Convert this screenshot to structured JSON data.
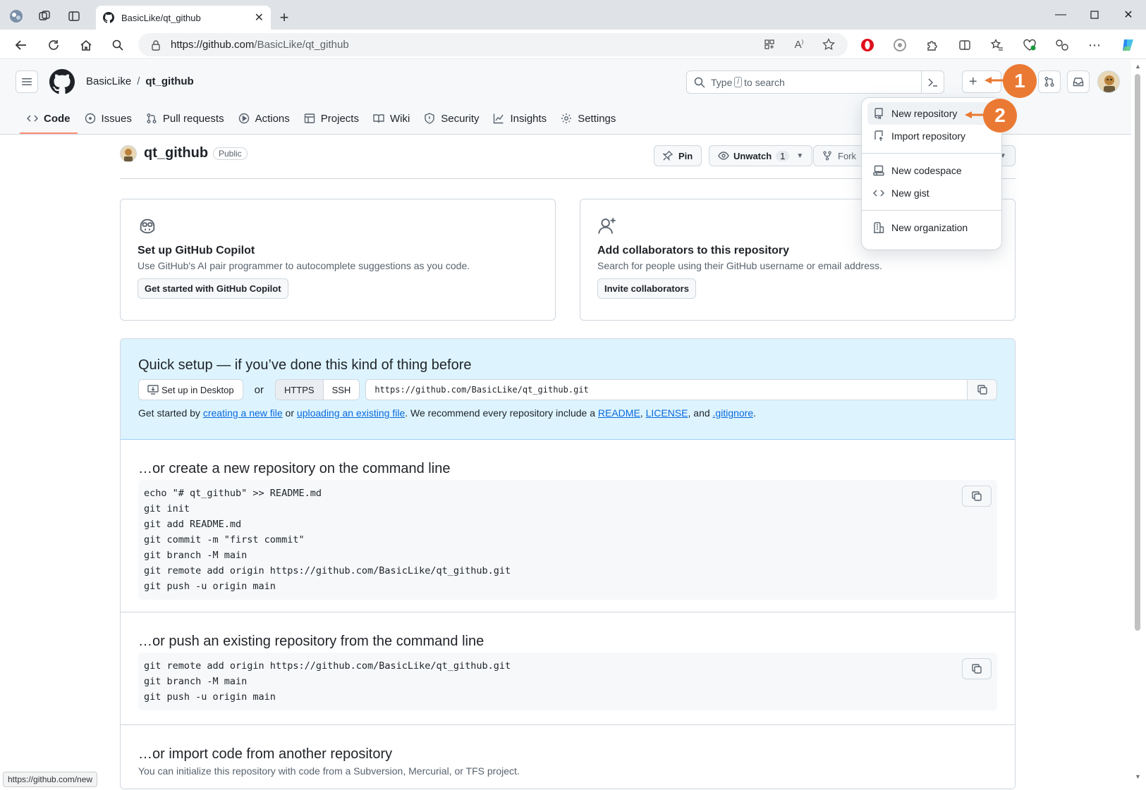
{
  "browser": {
    "tab_title": "BasicLike/qt_github",
    "url_host": "https://github.com",
    "url_path": "/BasicLike/qt_github",
    "status_url": "https://github.com/new"
  },
  "header": {
    "owner": "BasicLike",
    "separator": "/",
    "repo": "qt_github",
    "search_prefix": "Type",
    "search_key": "/",
    "search_suffix": "to search"
  },
  "repo_tabs": [
    {
      "label": "Code",
      "icon": "code-icon"
    },
    {
      "label": "Issues",
      "icon": "issue-icon"
    },
    {
      "label": "Pull requests",
      "icon": "pull-request-icon"
    },
    {
      "label": "Actions",
      "icon": "play-icon"
    },
    {
      "label": "Projects",
      "icon": "table-icon"
    },
    {
      "label": "Wiki",
      "icon": "book-icon"
    },
    {
      "label": "Security",
      "icon": "shield-icon"
    },
    {
      "label": "Insights",
      "icon": "graph-icon"
    },
    {
      "label": "Settings",
      "icon": "gear-icon"
    }
  ],
  "repo": {
    "name": "qt_github",
    "visibility": "Public",
    "pin_label": "Pin",
    "watch_label": "Unwatch",
    "watch_count": "1",
    "fork_label": "Fork"
  },
  "cards": {
    "copilot": {
      "title": "Set up GitHub Copilot",
      "desc": "Use GitHub's AI pair programmer to autocomplete suggestions as you code.",
      "button": "Get started with GitHub Copilot"
    },
    "collab": {
      "title": "Add collaborators to this repository",
      "desc": "Search for people using their GitHub username or email address.",
      "button": "Invite collaborators"
    }
  },
  "quick_setup": {
    "title": "Quick setup — if you’ve done this kind of thing before",
    "desktop_button": "Set up in Desktop",
    "or": "or",
    "https": "HTTPS",
    "ssh": "SSH",
    "clone_url": "https://github.com/BasicLike/qt_github.git",
    "t1": "Get started by ",
    "link1": "creating a new file",
    "t2": " or ",
    "link2": "uploading an existing file",
    "t3": ". We recommend every repository include a ",
    "link3": "README",
    "t4": ", ",
    "link4": "LICENSE",
    "t5": ", and ",
    "link5": ".gitignore",
    "t6": "."
  },
  "sections": {
    "create_title": "…or create a new repository on the command line",
    "create_code": [
      "echo \"# qt_github\" >> README.md",
      "git init",
      "git add README.md",
      "git commit -m \"first commit\"",
      "git branch -M main",
      "git remote add origin https://github.com/BasicLike/qt_github.git",
      "git push -u origin main"
    ],
    "push_title": "…or push an existing repository from the command line",
    "push_code": [
      "git remote add origin https://github.com/BasicLike/qt_github.git",
      "git branch -M main",
      "git push -u origin main"
    ],
    "import_title": "…or import code from another repository",
    "import_desc": "You can initialize this repository with code from a Subversion, Mercurial, or TFS project."
  },
  "dropdown": {
    "items": [
      {
        "label": "New repository",
        "icon": "repo-icon"
      },
      {
        "label": "Import repository",
        "icon": "repo-push-icon"
      },
      {
        "label": "New codespace",
        "icon": "codespaces-icon"
      },
      {
        "label": "New gist",
        "icon": "code-icon"
      },
      {
        "label": "New organization",
        "icon": "organization-icon"
      }
    ]
  },
  "callouts": [
    "1",
    "2"
  ],
  "colors": {
    "accent_orange": "#ea7a33",
    "link_blue": "#0969da",
    "quick_bg": "#ddf4ff",
    "active_tab_underline": "#fd8c73"
  }
}
